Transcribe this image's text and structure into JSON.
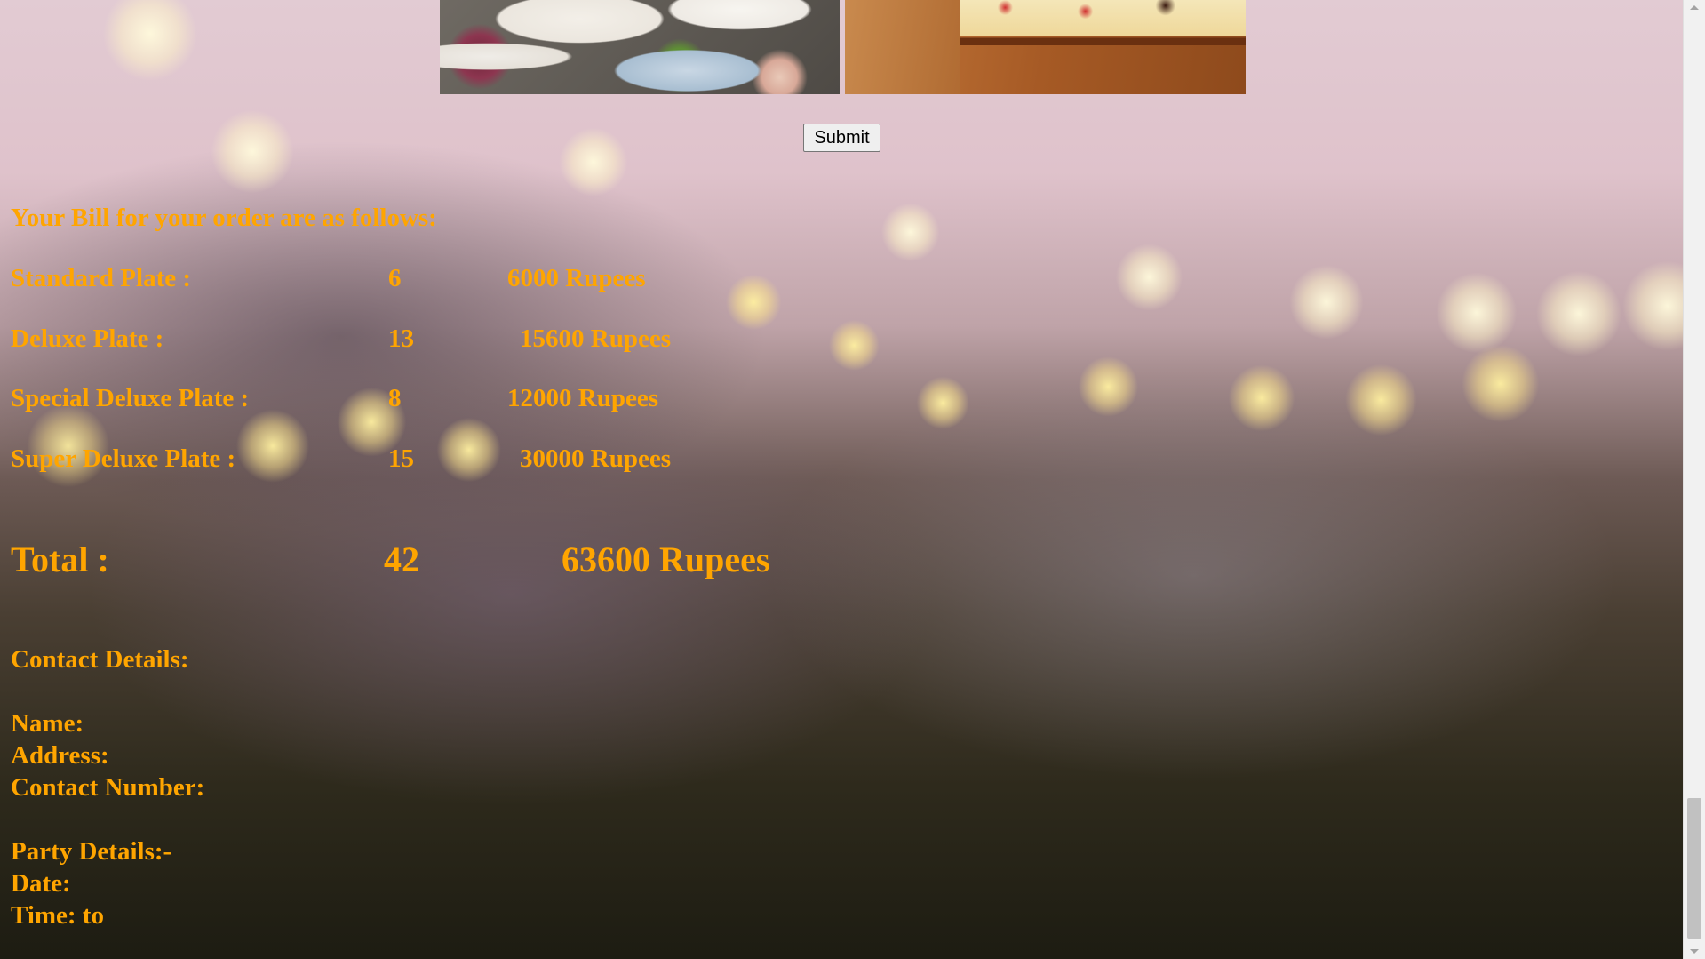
{
  "form": {
    "submit_label": "Submit"
  },
  "bill": {
    "heading": "Your Bill for your order are as follows:",
    "items": [
      {
        "label": "Standard Plate :",
        "qty": "6",
        "amount": "6000 Rupees"
      },
      {
        "label": "Deluxe Plate :",
        "qty": "13",
        "amount": "15600 Rupees"
      },
      {
        "label": "Special Deluxe Plate :",
        "qty": "8",
        "amount": "12000 Rupees"
      },
      {
        "label": "Super Deluxe Plate :",
        "qty": "15",
        "amount": "30000 Rupees"
      }
    ],
    "total": {
      "label": "Total :",
      "qty": "42",
      "amount": "63600 Rupees"
    }
  },
  "contact": {
    "heading": "Contact Details:",
    "name_label": "Name:",
    "address_label": "Address:",
    "phone_label": "Contact Number:"
  },
  "party": {
    "heading": "Party Details:-",
    "date_label": "Date:",
    "time_label": "Time: to"
  },
  "colors": {
    "text_accent": "#ffa500"
  }
}
